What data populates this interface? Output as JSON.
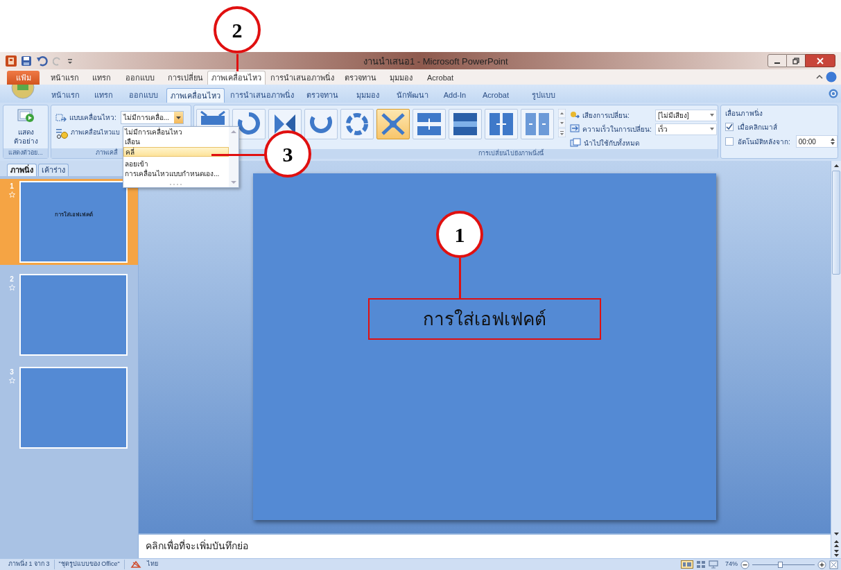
{
  "window": {
    "title": "งานนำเสนอ1 - Microsoft PowerPoint"
  },
  "file_tab": "แฟ้ม",
  "tabs": [
    {
      "label": "หน้าแรก",
      "selected": false
    },
    {
      "label": "แทรก",
      "selected": false
    },
    {
      "label": "ออกแบบ",
      "selected": false
    },
    {
      "label": "การเปลี่ยน",
      "selected": false
    },
    {
      "label": "ภาพเคลื่อนไหว",
      "selected": true
    },
    {
      "label": "การนำเสนอภาพนิ่ง",
      "selected": false
    },
    {
      "label": "ตรวจทาน",
      "selected": false
    },
    {
      "label": "มุมมอง",
      "selected": false
    },
    {
      "label": "Acrobat",
      "selected": false
    }
  ],
  "ribbon_tabs": [
    {
      "label": "หน้าแรก",
      "selected": false
    },
    {
      "label": "แทรก",
      "selected": false
    },
    {
      "label": "ออกแบบ",
      "selected": false
    },
    {
      "label": "ภาพเคลื่อนไหว",
      "selected": true
    },
    {
      "label": "การนำเสนอภาพนิ่ง",
      "selected": false
    },
    {
      "label": "ตรวจทาน",
      "selected": false
    },
    {
      "label": "มุมมอง",
      "selected": false
    },
    {
      "label": "นักพัฒนา",
      "selected": false
    },
    {
      "label": "Add-In",
      "selected": false
    },
    {
      "label": "Acrobat",
      "selected": false
    },
    {
      "label": "รูปแบบ",
      "selected": false
    }
  ],
  "preview_group": {
    "button_lines": [
      "แสดง",
      "ตัวอย่าง"
    ],
    "group_label": "แสดงตัวอย..."
  },
  "animations_group": {
    "animate_label": "แบบเคลื่อนไหว:",
    "animate_value": "ไม่มีการเคลื่อ...",
    "custom_label": "ภาพเคลื่อนไหวแบ",
    "group_label": "ภาพเคลื่"
  },
  "animate_dropdown": [
    {
      "label": "ไม่มีการเคลื่อนไหว",
      "selected": false
    },
    {
      "label": "เลือน",
      "selected": false
    },
    {
      "label": "คลี่",
      "selected": true
    },
    {
      "label": "ลอยเข้า",
      "selected": false
    },
    {
      "label": "การเคลื่อนไหวแบบกำหนดเอง...",
      "selected": false
    }
  ],
  "transitions_group": {
    "thumbnails": [
      {
        "selected": false
      },
      {
        "selected": false
      },
      {
        "selected": false
      },
      {
        "selected": false
      },
      {
        "selected": false
      },
      {
        "selected": true
      },
      {
        "selected": false
      },
      {
        "selected": false
      },
      {
        "selected": false
      },
      {
        "selected": false
      }
    ],
    "sound_label": "เสียงการเปลี่ยน:",
    "sound_value": "[ไม่มีเสียง]",
    "speed_label": "ความเร็วในการเปลี่ยน:",
    "speed_value": "เร็ว",
    "apply_all": "นำไปใช้กับทั้งหมด",
    "group_label": "การเปลี่ยนไปยังภาพนิ่งนี้"
  },
  "advance_group": {
    "title": "เลื่อนภาพนิ่ง",
    "on_click": {
      "label": "เมื่อคลิกเมาส์",
      "checked": true
    },
    "automatic": {
      "label": "อัตโนมัติหลังจาก:",
      "checked": false,
      "value": "00:00"
    }
  },
  "pane_tabs": [
    {
      "label": "ภาพนิ่ง",
      "selected": true
    },
    {
      "label": "เค้าร่าง",
      "selected": false
    }
  ],
  "slides": [
    {
      "number": "1",
      "selected": true,
      "title": "การใส่เอฟเฟคต์"
    },
    {
      "number": "2",
      "selected": false
    },
    {
      "number": "3",
      "selected": false
    }
  ],
  "slide": {
    "title": "การใส่เอฟเฟคต์"
  },
  "notes": "คลิกเพื่อที่จะเพิ่มบันทึกย่อ",
  "status_bar": {
    "slide_info": "ภาพนิ่ง 1 จาก 3",
    "theme": "\"ชุดรูปแบบของ Office\"",
    "language": "ไทย",
    "zoom": "74%",
    "zoom_level": {
      "level": 0.45
    }
  },
  "callouts": [
    {
      "number": "2"
    },
    {
      "number": "3"
    },
    {
      "number": "1"
    }
  ]
}
